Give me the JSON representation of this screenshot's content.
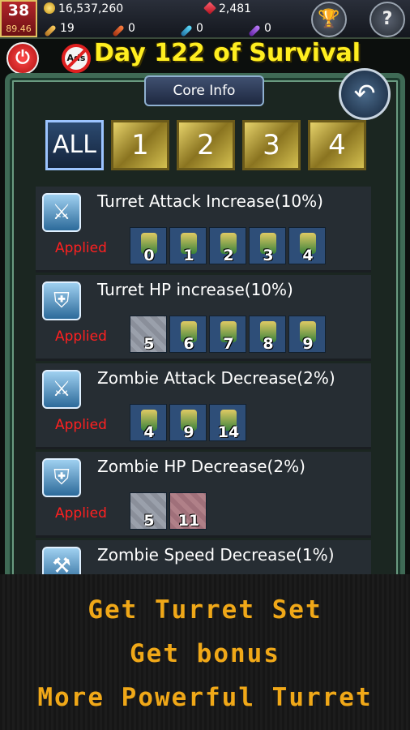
{
  "header": {
    "level": "38",
    "level_progress": "89.46",
    "coins": "16,537,260",
    "gems": "2,481",
    "items": [
      "19",
      "0",
      "0",
      "0"
    ],
    "trophy_icon": "trophy-icon",
    "help_label": "?"
  },
  "title_bar": {
    "power_icon": "power-icon",
    "no_ads_label": "Ads",
    "day_title": "Day 122 of Survival"
  },
  "panel": {
    "tab_label": "Core Info",
    "back_icon": "back-arrow-icon",
    "filters": [
      "ALL",
      "1",
      "2",
      "3",
      "4"
    ],
    "selected_filter": "ALL"
  },
  "cores": [
    {
      "title": "Turret Attack Increase(10%)",
      "status": "Applied",
      "icon": "crossed-swords-icon",
      "turrets": [
        "0",
        "1",
        "2",
        "3",
        "4"
      ]
    },
    {
      "title": "Turret HP increase(10%)",
      "status": "Applied",
      "icon": "shield-icon",
      "turrets": [
        "5",
        "6",
        "7",
        "8",
        "9"
      ]
    },
    {
      "title": "Zombie Attack Decrease(2%)",
      "status": "Applied",
      "icon": "broken-sword-icon",
      "turrets": [
        "4",
        "9",
        "14"
      ]
    },
    {
      "title": "Zombie HP Decrease(2%)",
      "status": "Applied",
      "icon": "broken-shield-icon",
      "turrets": [
        "5",
        "11"
      ]
    },
    {
      "title": "Zombie Speed Decrease(1%)",
      "status": "",
      "icon": "slow-foot-icon",
      "turrets": []
    }
  ],
  "promo": {
    "line1": "Get Turret Set",
    "line2": "Get bonus",
    "line3": "More Powerful Turret"
  },
  "colors": {
    "title_yellow": "#ffee20",
    "applied_red": "#ff2020",
    "promo_orange": "#f0a818",
    "frame_green": "#3f6a55"
  }
}
